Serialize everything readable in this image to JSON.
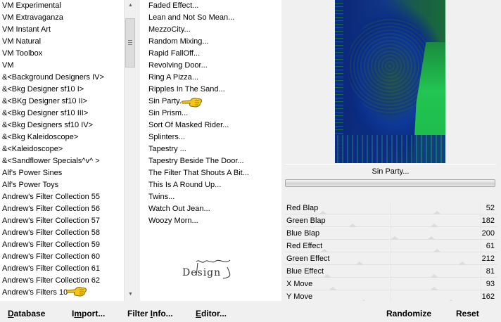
{
  "categories": [
    "VM Experimental",
    "VM Extravaganza",
    "VM Instant Art",
    "VM Natural",
    "VM Toolbox",
    "VM",
    "&<Background Designers IV>",
    "&<Bkg Designer sf10 I>",
    "&<BKg Designer sf10 II>",
    "&<Bkg Designer sf10 III>",
    "&<Bkg Designers sf10 IV>",
    "&<Bkg Kaleidoscope>",
    "&<Kaleidoscope>",
    "&<Sandflower Specials^v^ >",
    "Alf's Power Sines",
    "Alf's Power Toys",
    "Andrew's Filter Collection 55",
    "Andrew's Filter Collection 56",
    "Andrew's Filter Collection 57",
    "Andrew's Filter Collection 58",
    "Andrew's Filter Collection 59",
    "Andrew's Filter Collection 60",
    "Andrew's Filter Collection 61",
    "Andrew's Filter Collection 62",
    "Andrew's Filters 10"
  ],
  "filters": [
    "Faded Effect...",
    "Lean and Not So Mean...",
    "MezzoCity...",
    "Random Mixing...",
    "Rapid FallOff...",
    "Revolving Door...",
    "Ring A Pizza...",
    "Ripples In The Sand...",
    "Sin Party...",
    "Sin Prism...",
    "Sort Of Masked Rider...",
    "Splinters...",
    "Tapestry ...",
    "Tapestry Beside The Door...",
    "The Filter That Shouts A Bit...",
    "This Is A Round Up...",
    "Twins...",
    "Watch Out Jean...",
    "Woozy Morn..."
  ],
  "watermark": "Design",
  "selected_filter": "Sin Party...",
  "parameters": [
    {
      "label": "Red Blap",
      "value": "52"
    },
    {
      "label": "Green Blap",
      "value": "182"
    },
    {
      "label": "Blue Blap",
      "value": "200"
    },
    {
      "label": "Red Effect",
      "value": "61"
    },
    {
      "label": "Green Effect",
      "value": "212"
    },
    {
      "label": "Blue Effect",
      "value": "81"
    },
    {
      "label": "X Move",
      "value": "93"
    },
    {
      "label": "Y Move",
      "value": "162"
    }
  ],
  "buttons": {
    "database": {
      "accel": "D",
      "rest": "atabase"
    },
    "import": {
      "pre": "I",
      "accel": "m",
      "rest": "port..."
    },
    "filter_info": {
      "pre": "Filter ",
      "accel": "I",
      "rest": "nfo..."
    },
    "editor": {
      "accel": "E",
      "rest": "ditor..."
    },
    "randomize": {
      "label": "Randomize"
    },
    "reset": {
      "label": "Reset"
    }
  },
  "colors": {
    "hand": "#f5c518",
    "list_bg": "#ffffff",
    "window_bg": "#f0f0f0"
  },
  "icons": {
    "pointer": "pointing-hand-icon",
    "scroll_up": "scroll-up-arrow-icon",
    "scroll_down": "scroll-down-arrow-icon"
  }
}
